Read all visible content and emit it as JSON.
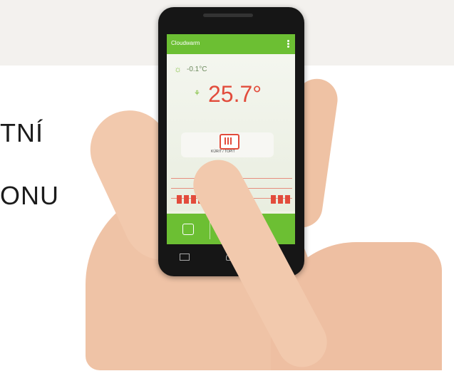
{
  "background_text": {
    "line1": "TNÍ",
    "line2": "ONU"
  },
  "phone_app": {
    "logo_text": "Cloudwarm",
    "outside_temperature": "-0.1°C",
    "room_temperature": "25.7°",
    "heat_label": "KÚRIT / TOPIT"
  },
  "colors": {
    "accent_green": "#6cbf33",
    "temperature_red": "#e24c3c"
  },
  "icons": {
    "sun": "sun-icon",
    "setpoint": "thermometer-icon",
    "menu": "overflow-menu-icon",
    "tab1": "hand-icon",
    "tab2": "target-icon",
    "nav_back": "back-icon",
    "nav_home": "home-icon"
  }
}
